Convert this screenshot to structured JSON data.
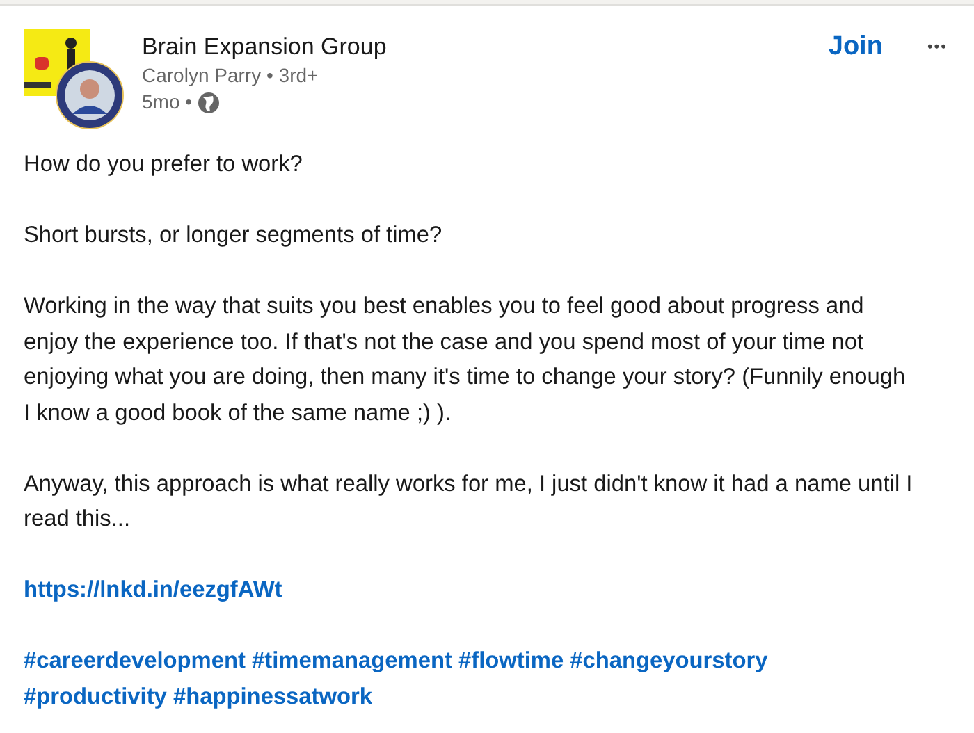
{
  "post": {
    "group_name": "Brain Expansion Group",
    "author": "Carolyn Parry",
    "separator": "•",
    "degree": "3rd+",
    "age": "5mo",
    "join_button": "Join",
    "more_button": "•••",
    "paragraphs": [
      "How do you prefer to work?",
      "Short bursts, or longer segments of time?",
      "Working in the way that suits you best enables you to feel good about progress and enjoy the experience too. If that's not the case and you spend most of your time not enjoying what you are doing, then many it's time to change your story? (Funnily enough I know a good book of the same name ;) ).",
      "Anyway, this approach is what really works for me, I just didn't know it had a name until I read this..."
    ],
    "link": "https://lnkd.in/eezgfAWt",
    "hashtags": [
      "#careerdevelopment",
      "#timemanagement",
      "#flowtime",
      "#changeyourstory",
      "#productivity",
      "#happinessatwork"
    ]
  }
}
